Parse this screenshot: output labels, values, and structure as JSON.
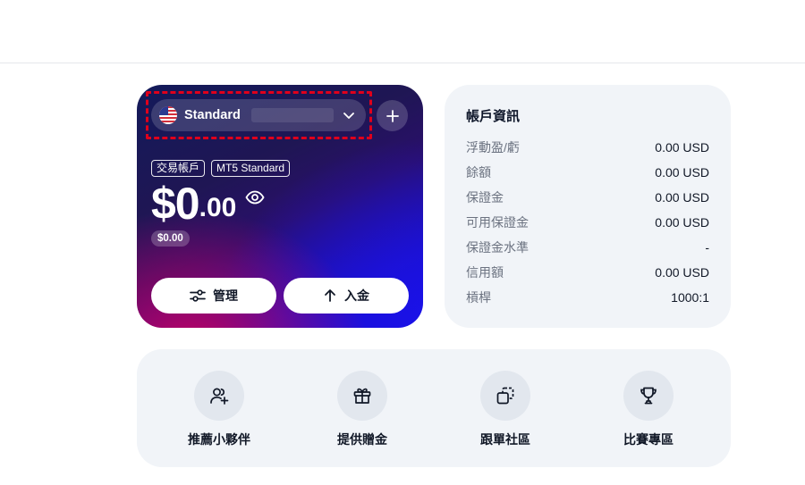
{
  "account_card": {
    "account_type": "Standard",
    "tags": [
      "交易帳戶",
      "MT5 Standard"
    ],
    "balance_main": "$0",
    "balance_cents": ".00",
    "secondary_balance": "$0.00",
    "buttons": {
      "manage": "管理",
      "deposit": "入金"
    }
  },
  "account_info": {
    "title": "帳戶資訊",
    "rows": [
      {
        "label": "浮動盈/虧",
        "value": "0.00 USD"
      },
      {
        "label": "餘額",
        "value": "0.00 USD"
      },
      {
        "label": "保證金",
        "value": "0.00 USD"
      },
      {
        "label": "可用保證金",
        "value": "0.00 USD"
      },
      {
        "label": "保證金水準",
        "value": "-"
      },
      {
        "label": "信用額",
        "value": "0.00 USD"
      },
      {
        "label": "槓桿",
        "value": "1000:1"
      }
    ]
  },
  "quick_actions": [
    {
      "label": "推薦小夥伴",
      "icon": "user-plus-icon"
    },
    {
      "label": "提供贈金",
      "icon": "gift-icon"
    },
    {
      "label": "跟單社區",
      "icon": "copy-icon"
    },
    {
      "label": "比賽專區",
      "icon": "trophy-icon"
    }
  ],
  "colors": {
    "highlight": "#e0001b",
    "panel_bg": "#f1f4f8",
    "icon_circle": "#e2e7ee"
  }
}
